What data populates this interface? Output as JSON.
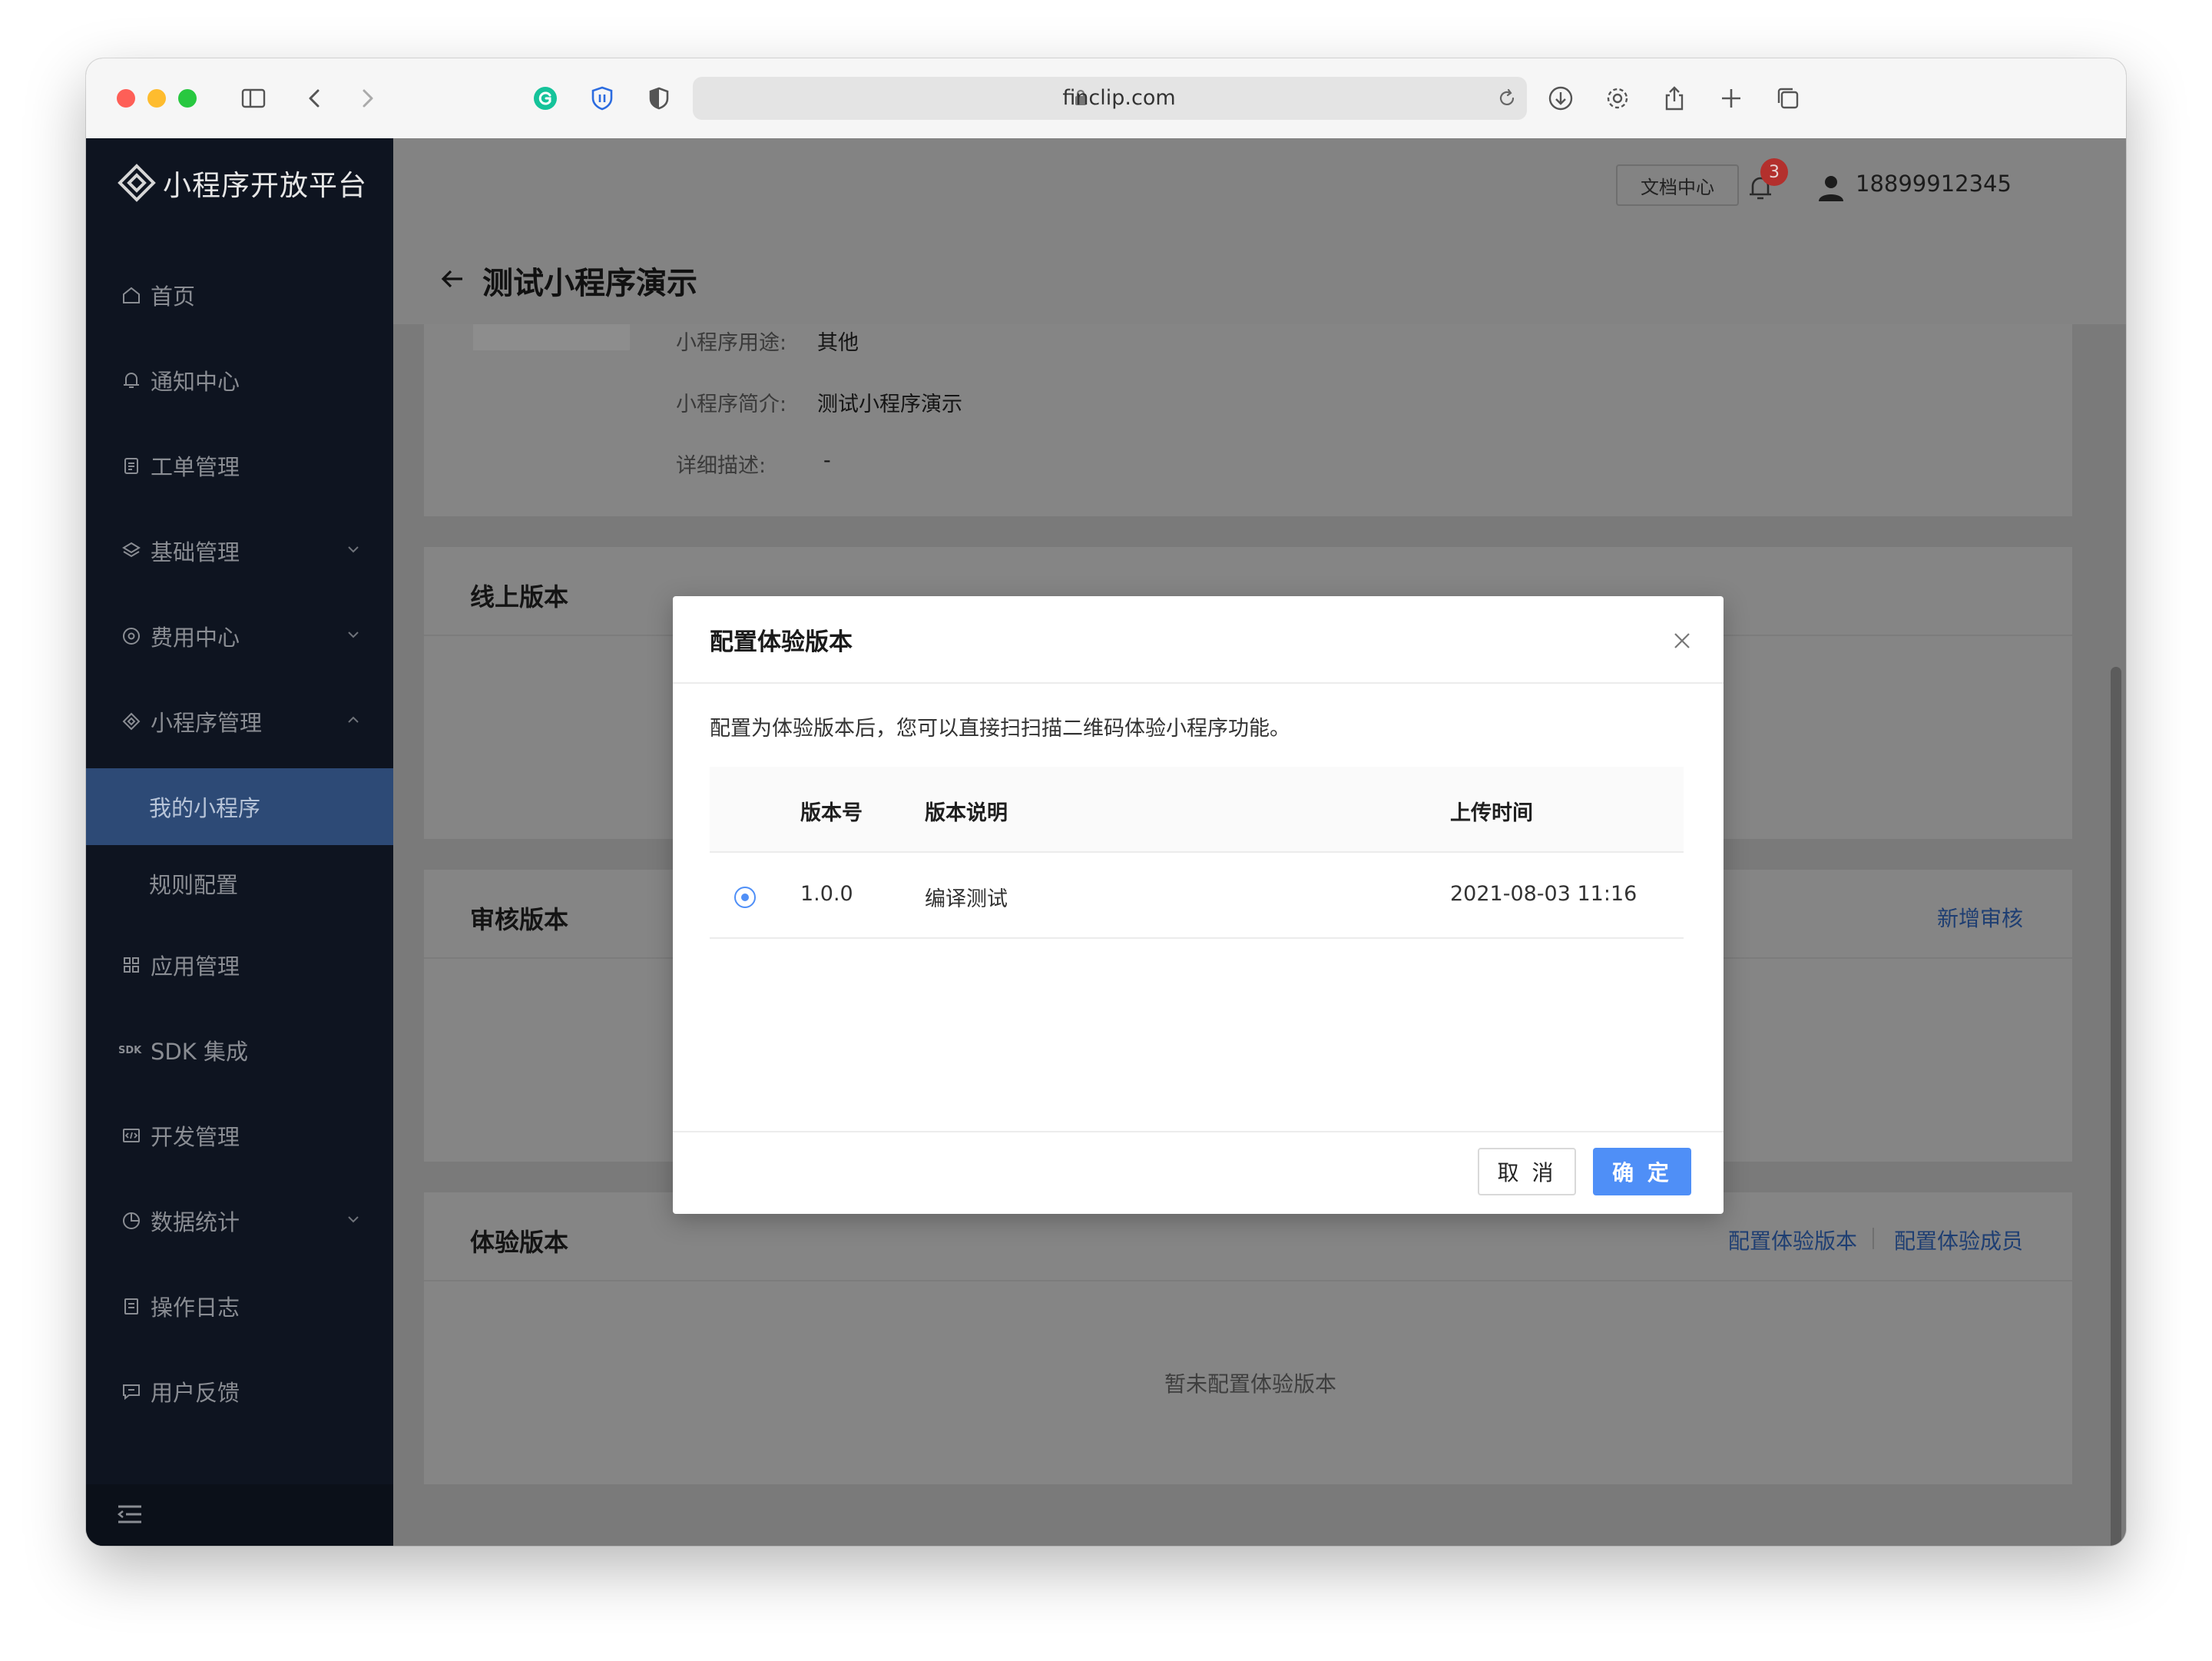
{
  "browser": {
    "url": "finclip.com"
  },
  "sidebar": {
    "logo_text": "小程序开放平台",
    "items": [
      {
        "label": "首页",
        "icon": "home-icon"
      },
      {
        "label": "通知中心",
        "icon": "bell-icon"
      },
      {
        "label": "工单管理",
        "icon": "clipboard-icon"
      },
      {
        "label": "基础管理",
        "icon": "layers-icon"
      },
      {
        "label": "费用中心",
        "icon": "coin-icon"
      },
      {
        "label": "小程序管理",
        "icon": "diamond-icon"
      },
      {
        "label": "我的小程序"
      },
      {
        "label": "规则配置"
      },
      {
        "label": "应用管理",
        "icon": "grid-icon"
      },
      {
        "label": "SDK 集成",
        "icon": "sdk-icon",
        "icon_text": "SDK"
      },
      {
        "label": "开发管理",
        "icon": "code-icon"
      },
      {
        "label": "数据统计",
        "icon": "pie-icon"
      },
      {
        "label": "操作日志",
        "icon": "log-icon"
      },
      {
        "label": "用户反馈",
        "icon": "chat-icon"
      }
    ]
  },
  "topbar": {
    "doc_button": "文档中心",
    "notification_count": "3",
    "username": "18899912345"
  },
  "page": {
    "title": "测试小程序演示",
    "info": {
      "purpose_label": "小程序用途:",
      "purpose_value": "其他",
      "intro_label": "小程序简介:",
      "intro_value": "测试小程序演示",
      "detail_label": "详细描述:",
      "detail_value": "-"
    },
    "online_section_title": "线上版本",
    "review_section_title": "审核版本",
    "review_action": "新增审核",
    "trial_section_title": "体验版本",
    "trial_actions": [
      "配置体验版本",
      "配置体验成员"
    ],
    "trial_empty": "暂未配置体验版本"
  },
  "modal": {
    "title": "配置体验版本",
    "description": "配置为体验版本后，您可以直接扫扫描二维码体验小程序功能。",
    "columns": [
      "版本号",
      "版本说明",
      "上传时间"
    ],
    "rows": [
      {
        "version": "1.0.0",
        "note": "编译测试",
        "time": "2021-08-03 11:16",
        "selected": true
      }
    ],
    "cancel_label": "取 消",
    "ok_label": "确 定"
  },
  "colors": {
    "primary": "#4f8ff7",
    "sidebar_bg": "#0e1420",
    "sidebar_active": "#2d4a76",
    "badge": "#f5433d"
  }
}
